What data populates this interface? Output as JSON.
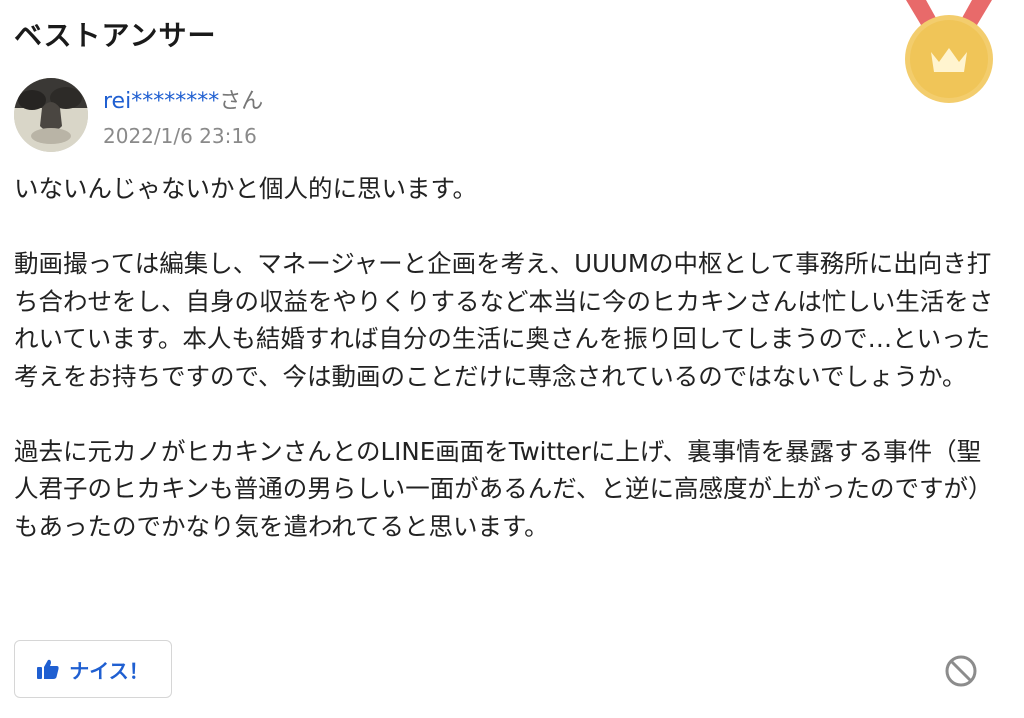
{
  "header": {
    "title": "ベストアンサー"
  },
  "badge": {
    "icon": "crown-medal-icon",
    "gold": "#f0c96a",
    "ribbon": "#e86a6a"
  },
  "answer": {
    "username": "rei********",
    "honorific": "さん",
    "datetime": "2022/1/6 23:16",
    "paragraphs": [
      "いないんじゃないかと個人的に思います。",
      "動画撮っては編集し、マネージャーと企画を考え、UUUMの中枢として事務所に出向き打ち合わせをし、自身の収益をやりくりするなど本当に今のヒカキンさんは忙しい生活をされいています。本人も結婚すれば自分の生活に奥さんを振り回してしまうので…といった考えをお持ちですので、今は動画のことだけに専念されているのではないでしょうか。",
      "過去に元カノがヒカキンさんとのLINE画面をTwitterに上げ、裏事情を暴露する事件（聖人君子のヒカキンも普通の男らしい一面があるんだ、と逆に高感度が上がったのですが）もあったのでかなり気を遣われてると思います。"
    ]
  },
  "actions": {
    "nice_label": "ナイス！",
    "nice_icon": "thumbs-up-icon",
    "report_icon": "block-icon"
  }
}
